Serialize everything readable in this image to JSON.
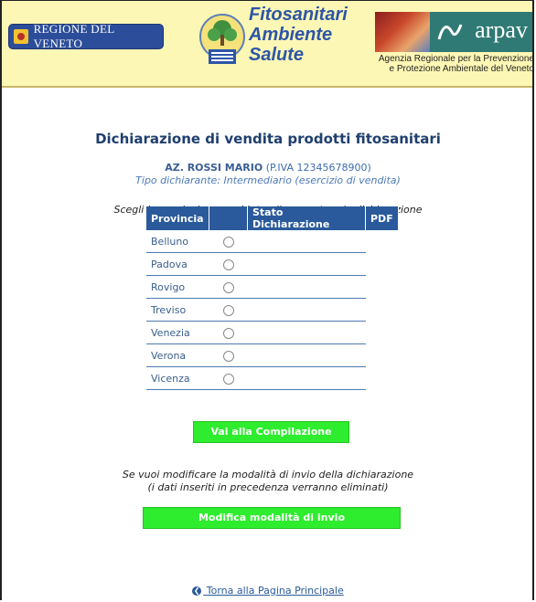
{
  "header": {
    "veneto_logo_text": "REGIONE DEL VENETO",
    "fito_title_lines": [
      "Fitosanitari",
      "Ambiente",
      "Salute"
    ],
    "arpav_logo_text": "arpav",
    "arpav_subtitle_line1": "Agenzia Regionale per la Prevenzione",
    "arpav_subtitle_line2": "e Protezione Ambientale del Veneto"
  },
  "main": {
    "title": "Dichiarazione di vendita prodotti fitosanitari",
    "company_name": "AZ. ROSSI MARIO",
    "company_vat": "(P.IVA 12345678900)",
    "declarant_type": "Tipo dichiarante: Intermediario (esercizio di vendita)",
    "instruction": "Scegli la provincia per cui intendi presentare la dichiarazione"
  },
  "table": {
    "headers": [
      "Provincia",
      "",
      "Stato Dichiarazione",
      "PDF"
    ],
    "rows": [
      {
        "province": "Belluno",
        "status": ""
      },
      {
        "province": "Padova",
        "status": ""
      },
      {
        "province": "Rovigo",
        "status": ""
      },
      {
        "province": "Treviso",
        "status": ""
      },
      {
        "province": "Venezia",
        "status": ""
      },
      {
        "province": "Verona",
        "status": ""
      },
      {
        "province": "Vicenza",
        "status": ""
      }
    ]
  },
  "actions": {
    "compile_label": "Vai alla Compilazione",
    "note_line1": "Se vuoi modificare la modalità di invio della dichiarazione",
    "note_line2": "(i dati inseriti in precedenza verranno eliminati)",
    "modify_label": "Modifica modalità di invio",
    "back_label": "Torna alla Pagina Principale"
  },
  "colors": {
    "header_bg": "#fdf7b5",
    "table_header_bg": "#2a5a9b",
    "button_bg": "#2eec2e",
    "title_color": "#1f3f6e"
  },
  "icons": {
    "veneto_emblem": "veneto-emblem-icon",
    "fito_emblem": "fitosanitari-emblem-icon",
    "back": "chevron-left-circle-icon"
  }
}
